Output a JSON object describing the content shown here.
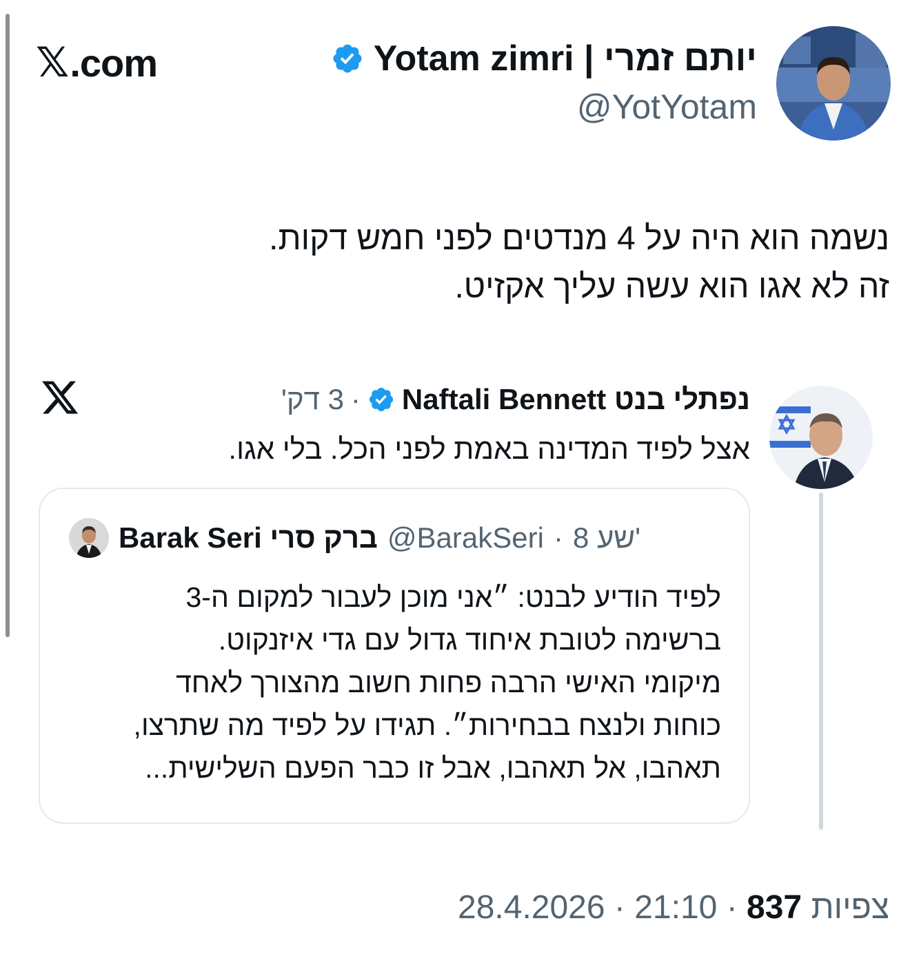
{
  "site": {
    "logo_text": ".com",
    "logo_glyph": "𝕏"
  },
  "author": {
    "display_name": "Yotam zimri | יותם זמרי",
    "handle": "@YotYotam",
    "verified": true,
    "avatar": "person-avatar"
  },
  "tweet": {
    "lines": [
      "נשמה הוא היה על 4 מנדטים לפני חמש דקות.",
      "זה לא אגו הוא עשה עליך אקזיט."
    ]
  },
  "embedded": {
    "source_icon": "x-logo-icon",
    "author_name": "נפתלי בנט Naftali Bennett",
    "verified": true,
    "meta": "3 דק'",
    "separator": "·",
    "text": "אצל לפיד המדינה באמת לפני הכל. בלי אגו.",
    "quote": {
      "author_name": "Barak Seri ברק סרי",
      "handle": "@BarakSeri",
      "separator": "·",
      "time": "8 שע'",
      "lines": [
        "לפיד הודיע לבנט: ״אני מוכן לעבור למקום ה-3",
        "ברשימה לטובת איחוד גדול עם גדי איזנקוט.",
        "מיקומי האישי הרבה פחות חשוב מהצורך לאחד",
        "כוחות ולנצח בבחירות״. תגידו על לפיד מה שתרצו,",
        "תאהבו, אל תאהבו, אבל זו כבר הפעם השלישית..."
      ]
    }
  },
  "footer": {
    "date": "28.4.2026",
    "time": "21:10",
    "views_count": "837",
    "views_label": "צפיות",
    "separator": "·"
  },
  "colors": {
    "verified_blue": "#1d9bf0",
    "secondary_text": "#536471",
    "primary_text": "#0f1419",
    "border": "#e5e9ec"
  }
}
